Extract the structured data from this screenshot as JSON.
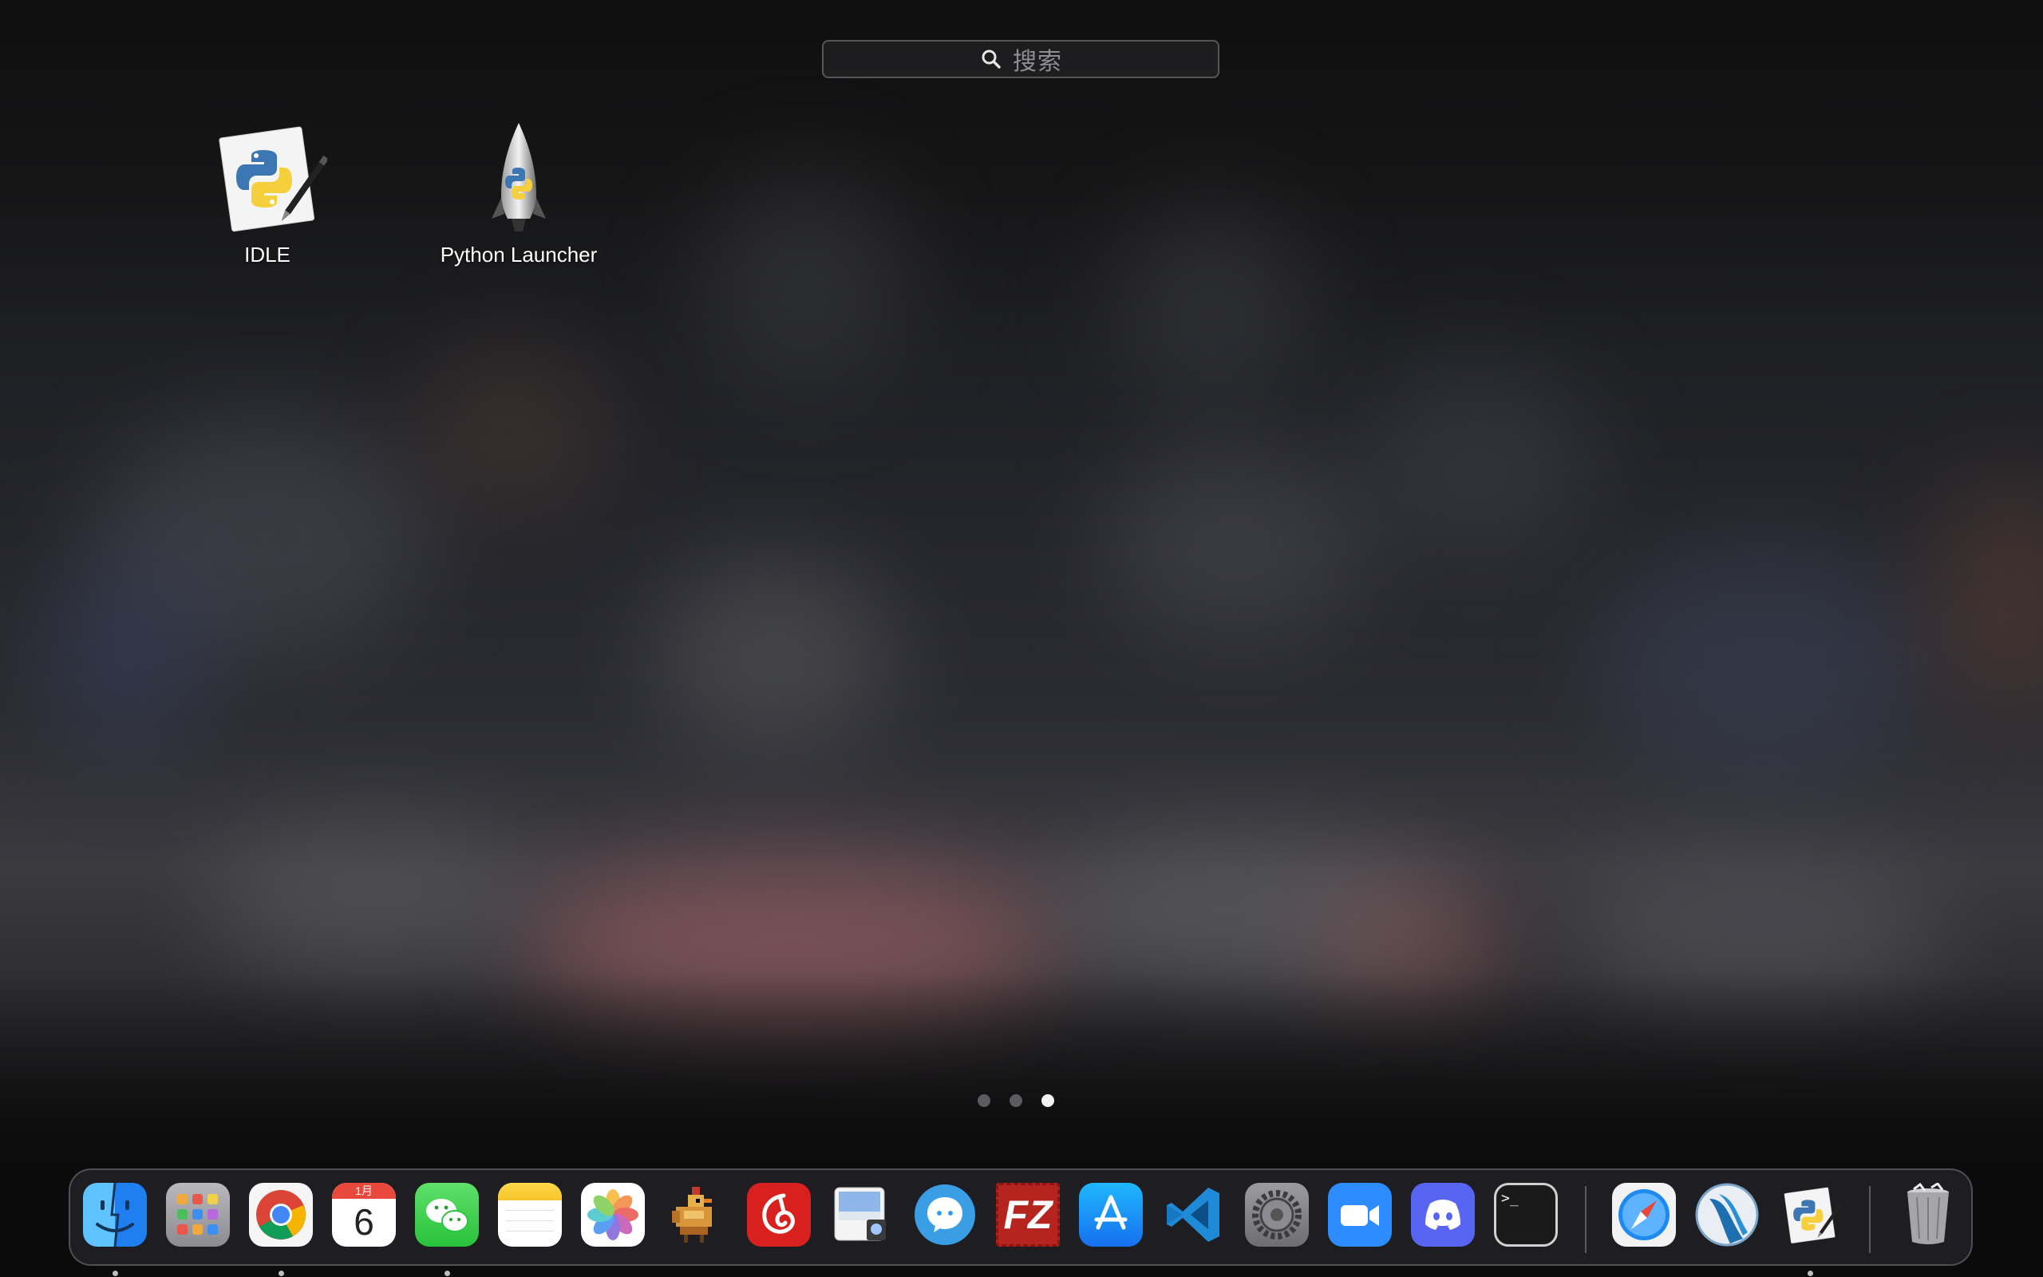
{
  "search": {
    "placeholder": "搜索",
    "icon": "search-icon"
  },
  "apps": [
    {
      "label": "IDLE",
      "icon": "idle-python-icon"
    },
    {
      "label": "Python Launcher",
      "icon": "python-launcher-rocket-icon"
    }
  ],
  "pages": {
    "count": 3,
    "current": 3
  },
  "dock": {
    "items": [
      {
        "name": "finder",
        "icon": "finder-icon",
        "running": true
      },
      {
        "name": "launchpad",
        "icon": "launchpad-icon",
        "running": false
      },
      {
        "name": "chrome",
        "icon": "chrome-icon",
        "running": true
      },
      {
        "name": "calendar",
        "icon": "calendar-icon",
        "running": false,
        "month": "1月",
        "day": "6"
      },
      {
        "name": "wechat",
        "icon": "wechat-icon",
        "running": true
      },
      {
        "name": "notes",
        "icon": "notes-icon",
        "running": false
      },
      {
        "name": "photos",
        "icon": "photos-icon",
        "running": false
      },
      {
        "name": "stardew-chicken",
        "icon": "pixel-chicken-icon",
        "running": false
      },
      {
        "name": "netease-music",
        "icon": "netease-music-icon",
        "running": false
      },
      {
        "name": "preview",
        "icon": "preview-icon",
        "running": false
      },
      {
        "name": "chat-bubble-app",
        "icon": "chat-bubble-icon",
        "running": false
      },
      {
        "name": "filezilla",
        "icon": "filezilla-icon",
        "running": false
      },
      {
        "name": "app-store",
        "icon": "app-store-icon",
        "running": false
      },
      {
        "name": "vscode",
        "icon": "vscode-icon",
        "running": false
      },
      {
        "name": "system-preferences",
        "icon": "gear-icon",
        "running": false
      },
      {
        "name": "zoom",
        "icon": "zoom-camera-icon",
        "running": false
      },
      {
        "name": "discord",
        "icon": "discord-icon",
        "running": false
      },
      {
        "name": "terminal",
        "icon": "terminal-icon",
        "running": false
      },
      {
        "name": "safari",
        "icon": "safari-icon",
        "running": false
      },
      {
        "name": "wave-app",
        "icon": "wave-icon",
        "running": false
      },
      {
        "name": "idle",
        "icon": "idle-python-icon",
        "running": true
      },
      {
        "name": "trash",
        "icon": "trash-icon",
        "running": false
      }
    ],
    "calendar": {
      "month": "1月",
      "day": "6"
    },
    "filezilla_text": "FZ",
    "terminal_text": ">_"
  }
}
